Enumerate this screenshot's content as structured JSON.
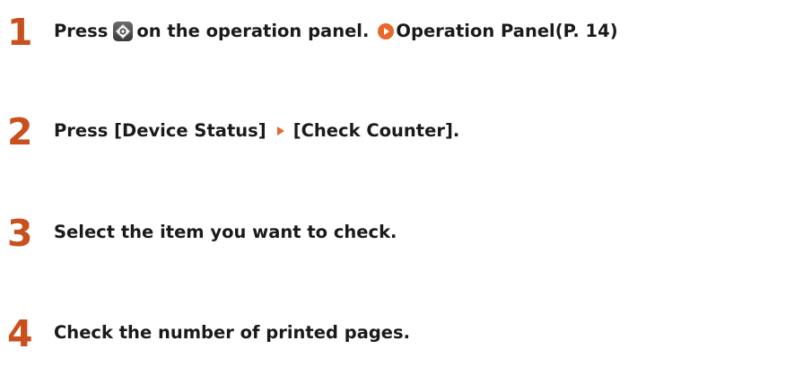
{
  "steps": [
    {
      "number": "1",
      "press": "Press",
      "after_icon": "on the operation panel.",
      "link": "Operation Panel(P. 14)"
    },
    {
      "number": "2",
      "part1": "Press [Device Status]",
      "part2": "[Check Counter]."
    },
    {
      "number": "3",
      "text": "Select the item you want to check."
    },
    {
      "number": "4",
      "text": "Check the number of printed pages."
    }
  ],
  "icons": {
    "home_button": "home-button-icon",
    "link_arrow": "link-arrow-icon",
    "menu_arrow": "menu-arrow-icon"
  },
  "colors": {
    "accent": "#c8501e",
    "arrow": "#e8682a",
    "text": "#1a1a1a"
  }
}
